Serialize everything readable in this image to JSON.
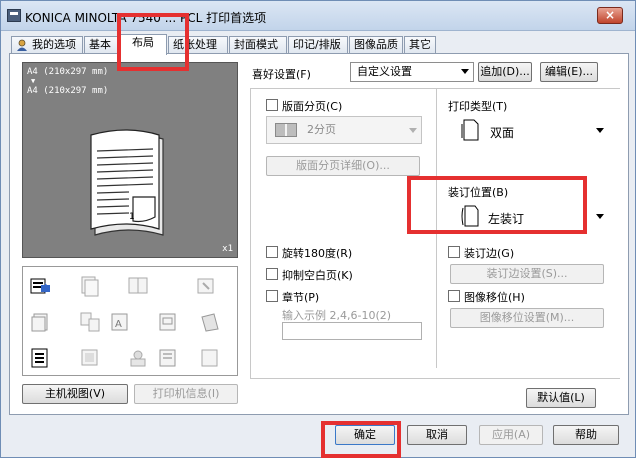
{
  "window": {
    "title": "KONICA MINOLTA 7540 ... PCL 打印首选项",
    "close": "×"
  },
  "tabs": [
    {
      "label": "我的选项"
    },
    {
      "label": "基本"
    },
    {
      "label": "布局"
    },
    {
      "label": "纸张处理"
    },
    {
      "label": "封面模式"
    },
    {
      "label": "印记/排版"
    },
    {
      "label": "图像品质"
    },
    {
      "label": "其它"
    }
  ],
  "preview": {
    "line1": "A4 (210x297 mm)",
    "arrow": "▼",
    "line2": "A4 (210x297 mm)",
    "multiplier": "x1"
  },
  "left_buttons": {
    "host_view": "主机视图(V)",
    "printer_info": "打印机信息(I)"
  },
  "favorites": {
    "label": "喜好设置(F)",
    "value": "自定义设置",
    "add": "追加(D)...",
    "edit": "编辑(E)..."
  },
  "pages_per_sheet": {
    "label": "版面分页(C)",
    "value": "2分页",
    "details": "版面分页详细(O)..."
  },
  "print_type": {
    "label": "打印类型(T)",
    "value": "双面"
  },
  "binding_position": {
    "label": "装订位置(B)",
    "value": "左装订"
  },
  "options": {
    "rotate": "旋转180度(R)",
    "suppress_blank": "抑制空白页(K)",
    "chapter": "章节(P)",
    "chapter_hint": "输入示例 2,4,6-10(2)",
    "binding_margin": "装订边(G)",
    "binding_margin_settings": "装订边设置(S)...",
    "image_shift": "图像移位(H)",
    "image_shift_settings": "图像移位设置(M)..."
  },
  "defaults_button": "默认值(L)",
  "footer": {
    "ok": "确定",
    "cancel": "取消",
    "apply": "应用(A)",
    "help": "帮助"
  },
  "colors": {
    "highlight": "#e53030"
  }
}
